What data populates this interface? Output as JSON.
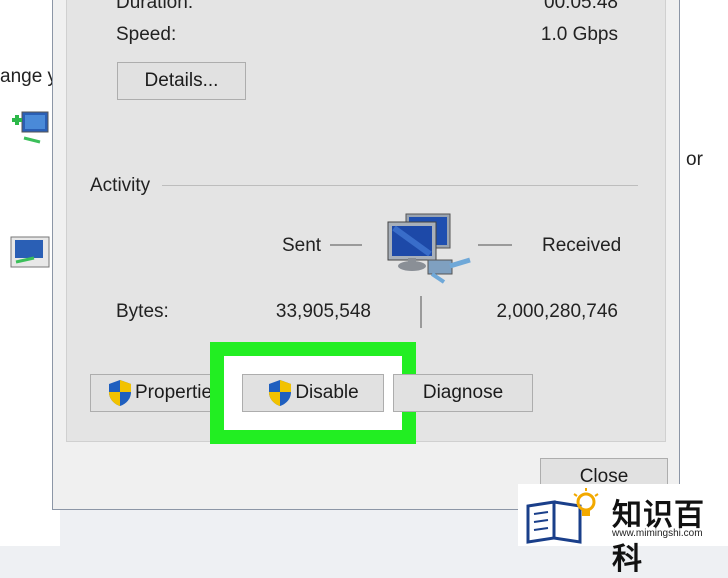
{
  "background": {
    "left_text": "ange y",
    "right_text": "or"
  },
  "dialog": {
    "duration_label": "Duration:",
    "duration_value": "00:05:48",
    "speed_label": "Speed:",
    "speed_value": "1.0 Gbps",
    "details_button": "Details...",
    "activity_label": "Activity",
    "sent_label": "Sent",
    "received_label": "Received",
    "bytes_label": "Bytes:",
    "bytes_sent": "33,905,548",
    "bytes_received": "2,000,280,746",
    "properties_button": "Properties",
    "disable_button": "Disable",
    "diagnose_button": "Diagnose",
    "close_button": "Close"
  },
  "watermark": {
    "brand": "知识百科",
    "url": "www.mimingshi.com"
  },
  "colors": {
    "highlight": "#22ee22",
    "shield_blue": "#1f5fbf",
    "shield_yellow": "#f2c200"
  }
}
